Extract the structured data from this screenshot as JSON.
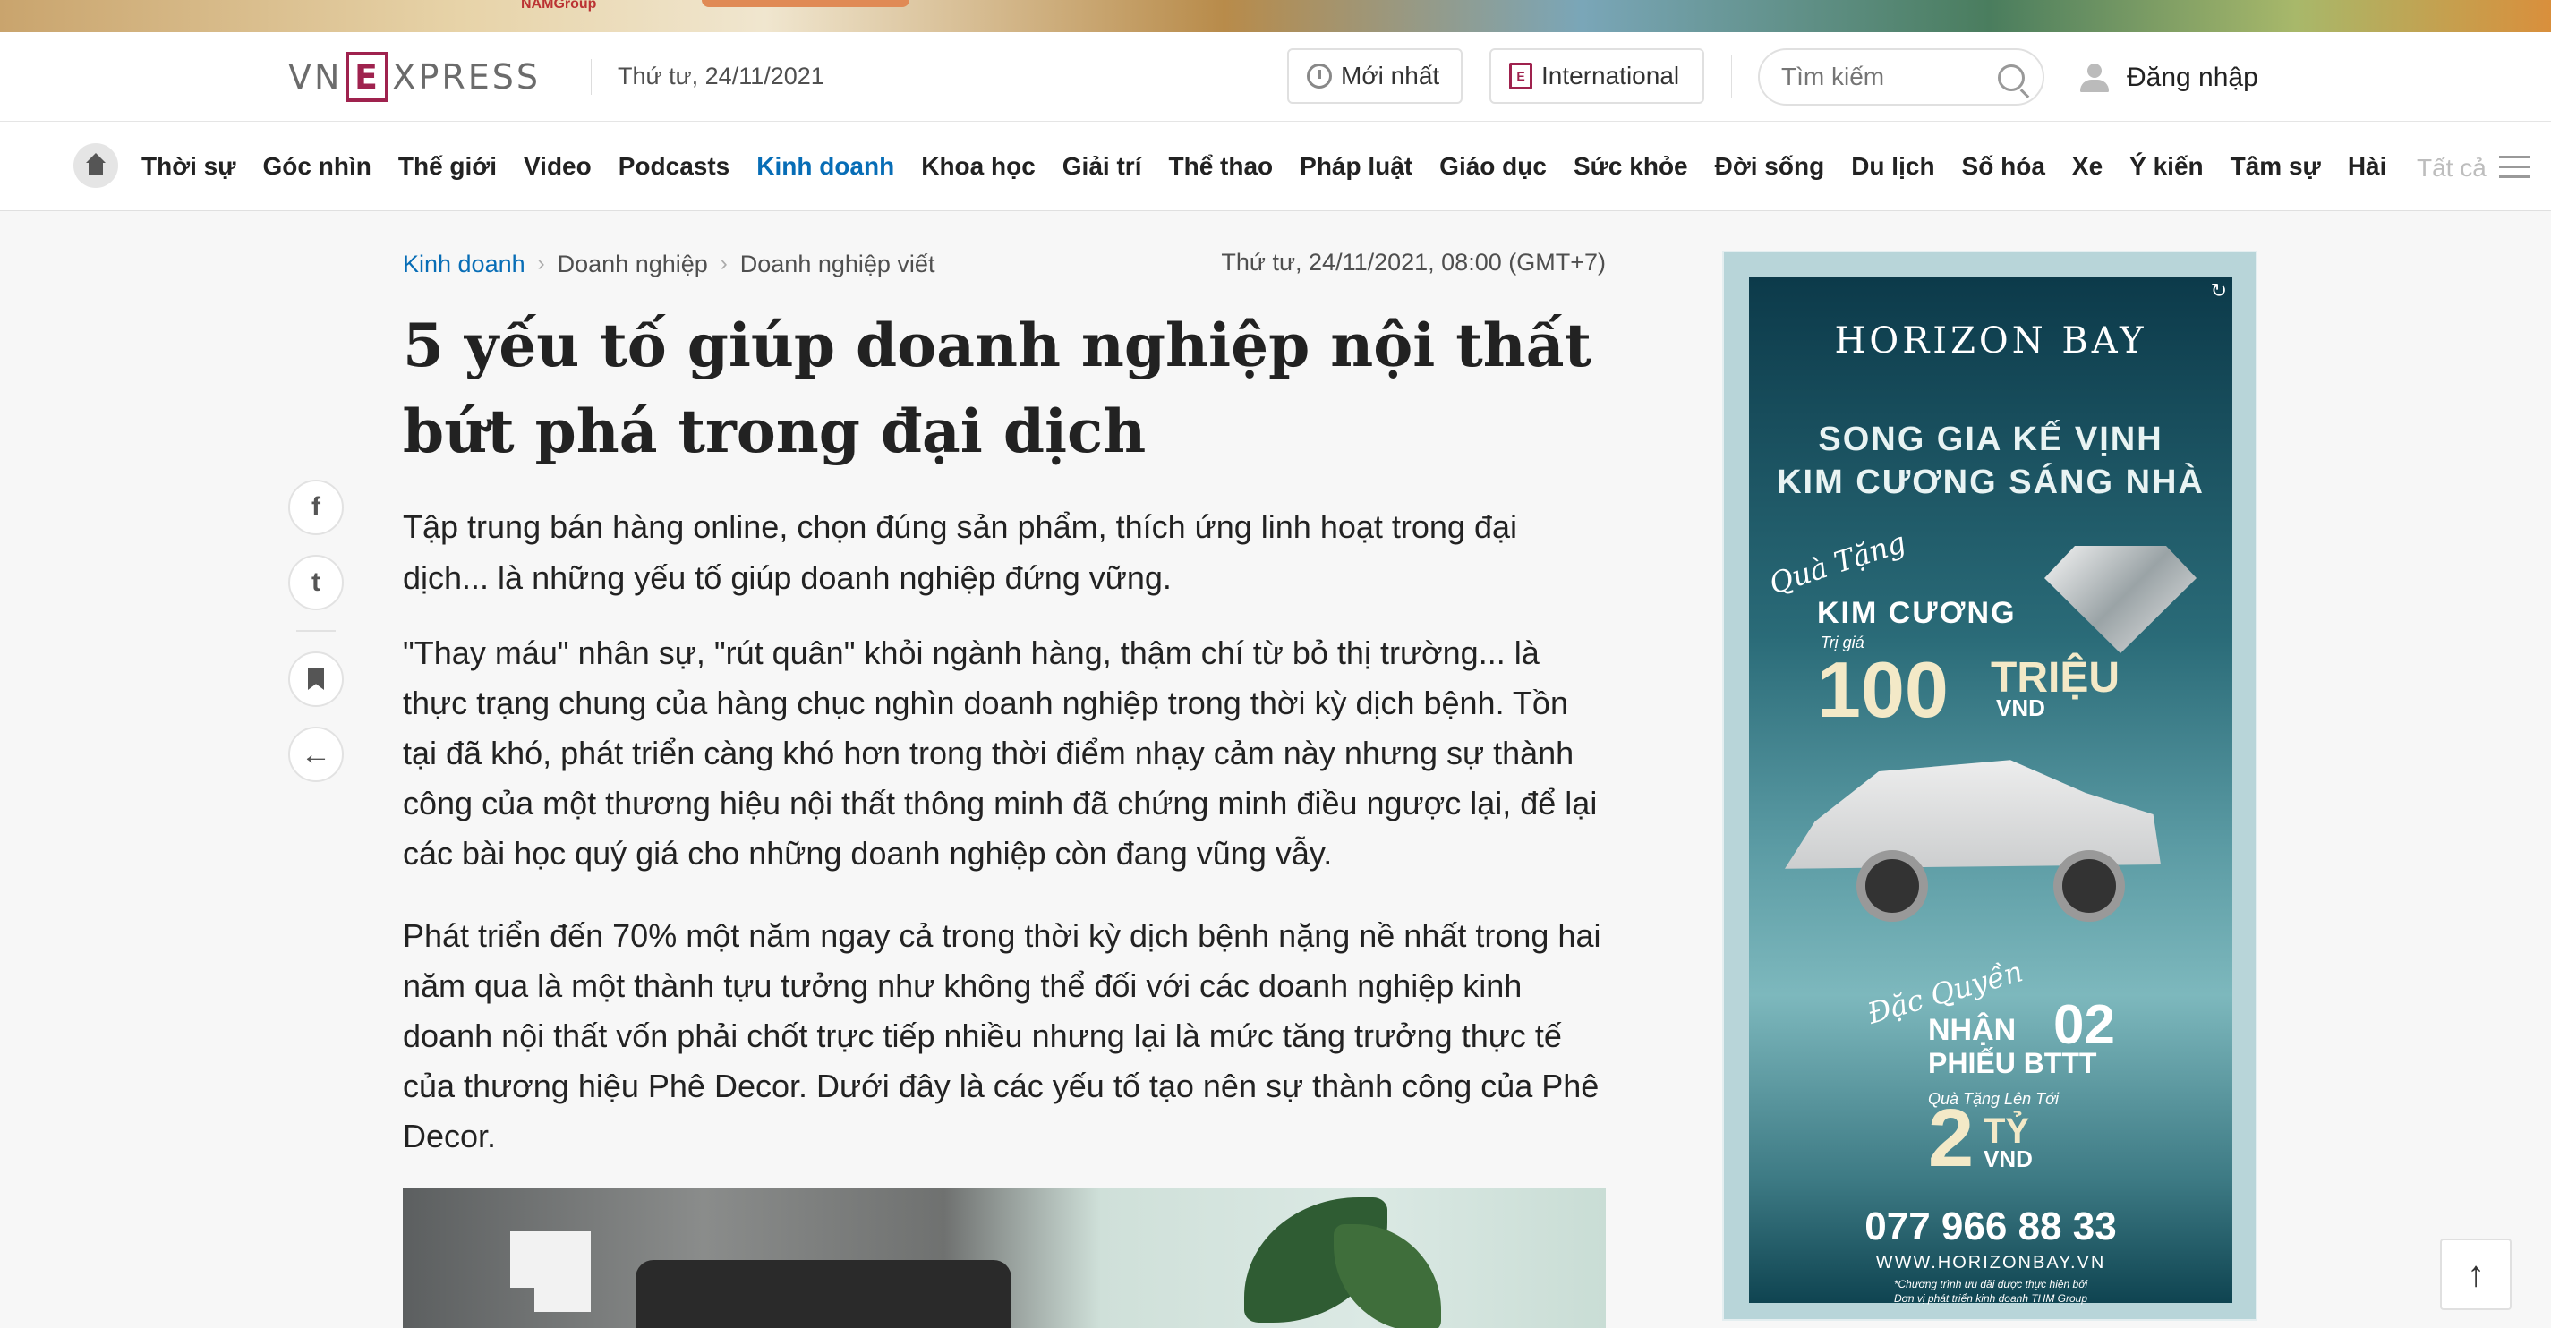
{
  "top_ad": {
    "brand_fragment": "NAMGroup"
  },
  "header": {
    "logo": {
      "part1": "VN",
      "letter": "E",
      "part2": "XPRESS"
    },
    "date": "Thứ tư, 24/11/2021",
    "latest_label": "Mới nhất",
    "international_label": "International",
    "international_icon": "E",
    "search_placeholder": "Tìm kiếm",
    "login_label": "Đăng nhập"
  },
  "nav": {
    "items": [
      "Thời sự",
      "Góc nhìn",
      "Thế giới",
      "Video",
      "Podcasts",
      "Kinh doanh",
      "Khoa học",
      "Giải trí",
      "Thể thao",
      "Pháp luật",
      "Giáo dục",
      "Sức khỏe",
      "Đời sống",
      "Du lịch",
      "Số hóa",
      "Xe",
      "Ý kiến",
      "Tâm sự",
      "Hài"
    ],
    "active": "Kinh doanh",
    "more_label": "Tất cả"
  },
  "social": {
    "facebook_glyph": "f",
    "twitter_glyph": "t",
    "back_glyph": "←"
  },
  "article": {
    "breadcrumbs": [
      "Kinh doanh",
      "Doanh nghiệp",
      "Doanh nghiệp viết"
    ],
    "date": "Thứ tư, 24/11/2021, 08:00 (GMT+7)",
    "title": "5 yếu tố giúp doanh nghiệp nội thất bứt phá trong đại dịch",
    "lead": "Tập trung bán hàng online, chọn đúng sản phẩm, thích ứng linh hoạt trong đại dịch... là những yếu tố giúp doanh nghiệp đứng vững.",
    "paragraphs": [
      "\"Thay máu\" nhân sự, \"rút quân\" khỏi ngành hàng, thậm chí từ bỏ thị trường... là thực trạng chung của hàng chục nghìn doanh nghiệp trong thời kỳ dịch bệnh. Tồn tại đã khó, phát triển càng khó hơn trong thời điểm nhạy cảm này nhưng sự thành công của một thương hiệu nội thất thông minh đã chứng minh điều ngược lại, để lại các bài học quý giá cho những doanh nghiệp còn đang vũng vẫy.",
      "Phát triển đến 70% một năm ngay cả trong thời kỳ dịch bệnh nặng nề nhất trong hai năm qua là một thành tựu tưởng như không thể đối với các doanh nghiệp kinh doanh nội thất vốn phải chốt trực tiếp nhiều nhưng lại là mức tăng trưởng thực tế của thương hiệu Phê Decor. Dưới đây là các yếu tố tạo nên sự thành công của Phê Decor."
    ]
  },
  "side_ad": {
    "brand": "HORIZON BAY",
    "line1": "SONG GIA KẾ VỊNH",
    "line2": "KIM CƯƠNG SÁNG NHÀ",
    "gift": "Quà Tặng",
    "diamond_label": "KIM CƯƠNG",
    "value_label": "Trị giá",
    "value_number": "100",
    "value_unit": "TRIỆU",
    "value_currency": "VND",
    "exclusive": "Đặc Quyền",
    "receive": "NHẬN",
    "receive_count": "02",
    "voucher": "PHIẾU BTTT",
    "gift_up_to": "Quà Tặng Lên Tới",
    "gift_number": "2",
    "gift_unit": "TỶ",
    "gift_currency": "VND",
    "phone": "077 966 88 33",
    "website": "WWW.HORIZONBAY.VN",
    "note1": "*Chương trình ưu đãi được thực hiện bởi",
    "note2": "Đơn vị phát triển kinh doanh THM Group"
  },
  "back_to_top": "↑"
}
